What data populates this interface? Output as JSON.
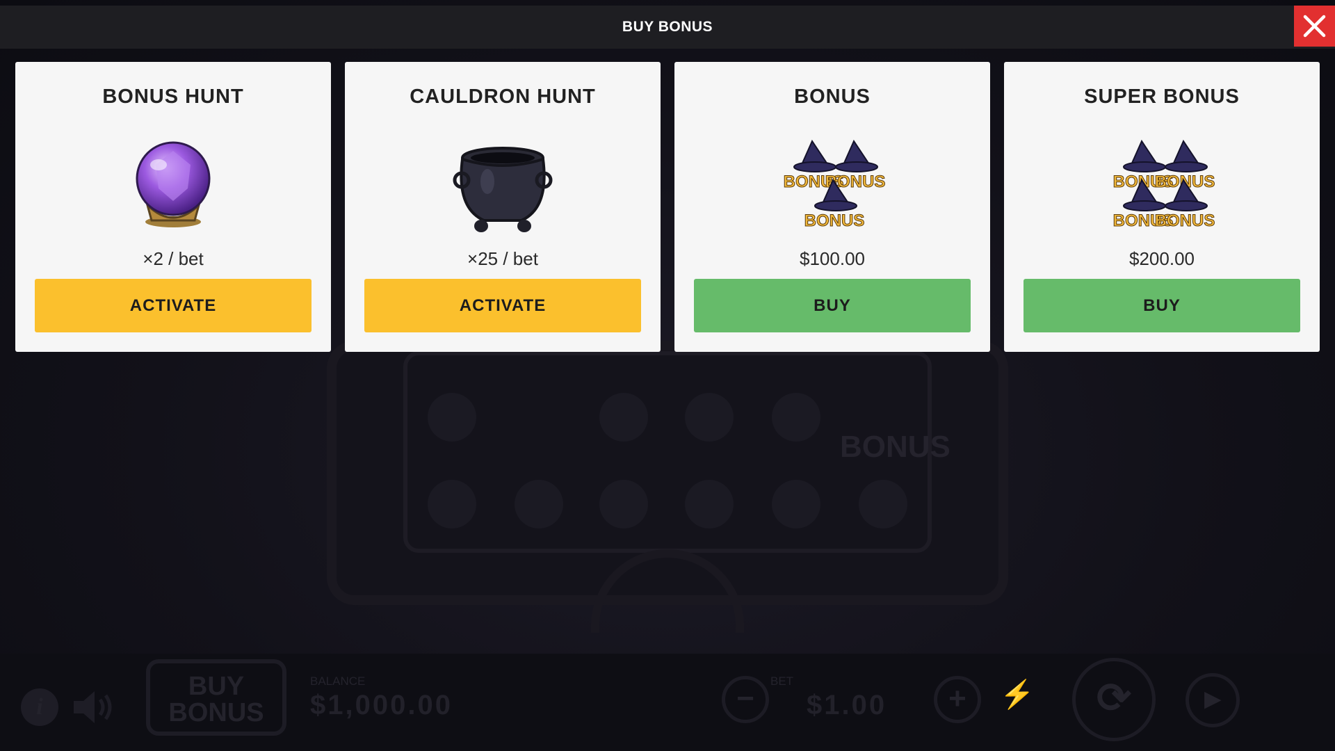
{
  "header": {
    "title": "BUY BONUS"
  },
  "close": {
    "icon": "close-icon"
  },
  "colors": {
    "activate_button": "#fbc02d",
    "buy_button": "#66bb6a",
    "close_button": "#e23030",
    "top_bar": "#1e1e22",
    "card_bg": "#f6f6f6"
  },
  "cards": [
    {
      "title": "BONUS HUNT",
      "icon": "crystal-ball-icon",
      "price": "×2 / bet",
      "button": "ACTIVATE"
    },
    {
      "title": "CAULDRON HUNT",
      "icon": "cauldron-icon",
      "price": "×25 / bet",
      "button": "ACTIVATE"
    },
    {
      "title": "BONUS",
      "icon": "witch-hat-bonus-x3-icon",
      "price": "$100.00",
      "button": "BUY"
    },
    {
      "title": "SUPER BONUS",
      "icon": "witch-hat-bonus-x4-icon",
      "price": "$200.00",
      "button": "BUY"
    }
  ],
  "game": {
    "reel_bonus_symbol": "BONUS",
    "buy_bonus_button": "BUY BONUS",
    "balance_label": "BALANCE",
    "balance_value": "$1,000.00",
    "bet_label": "BET",
    "bet_value": "$1.00"
  }
}
